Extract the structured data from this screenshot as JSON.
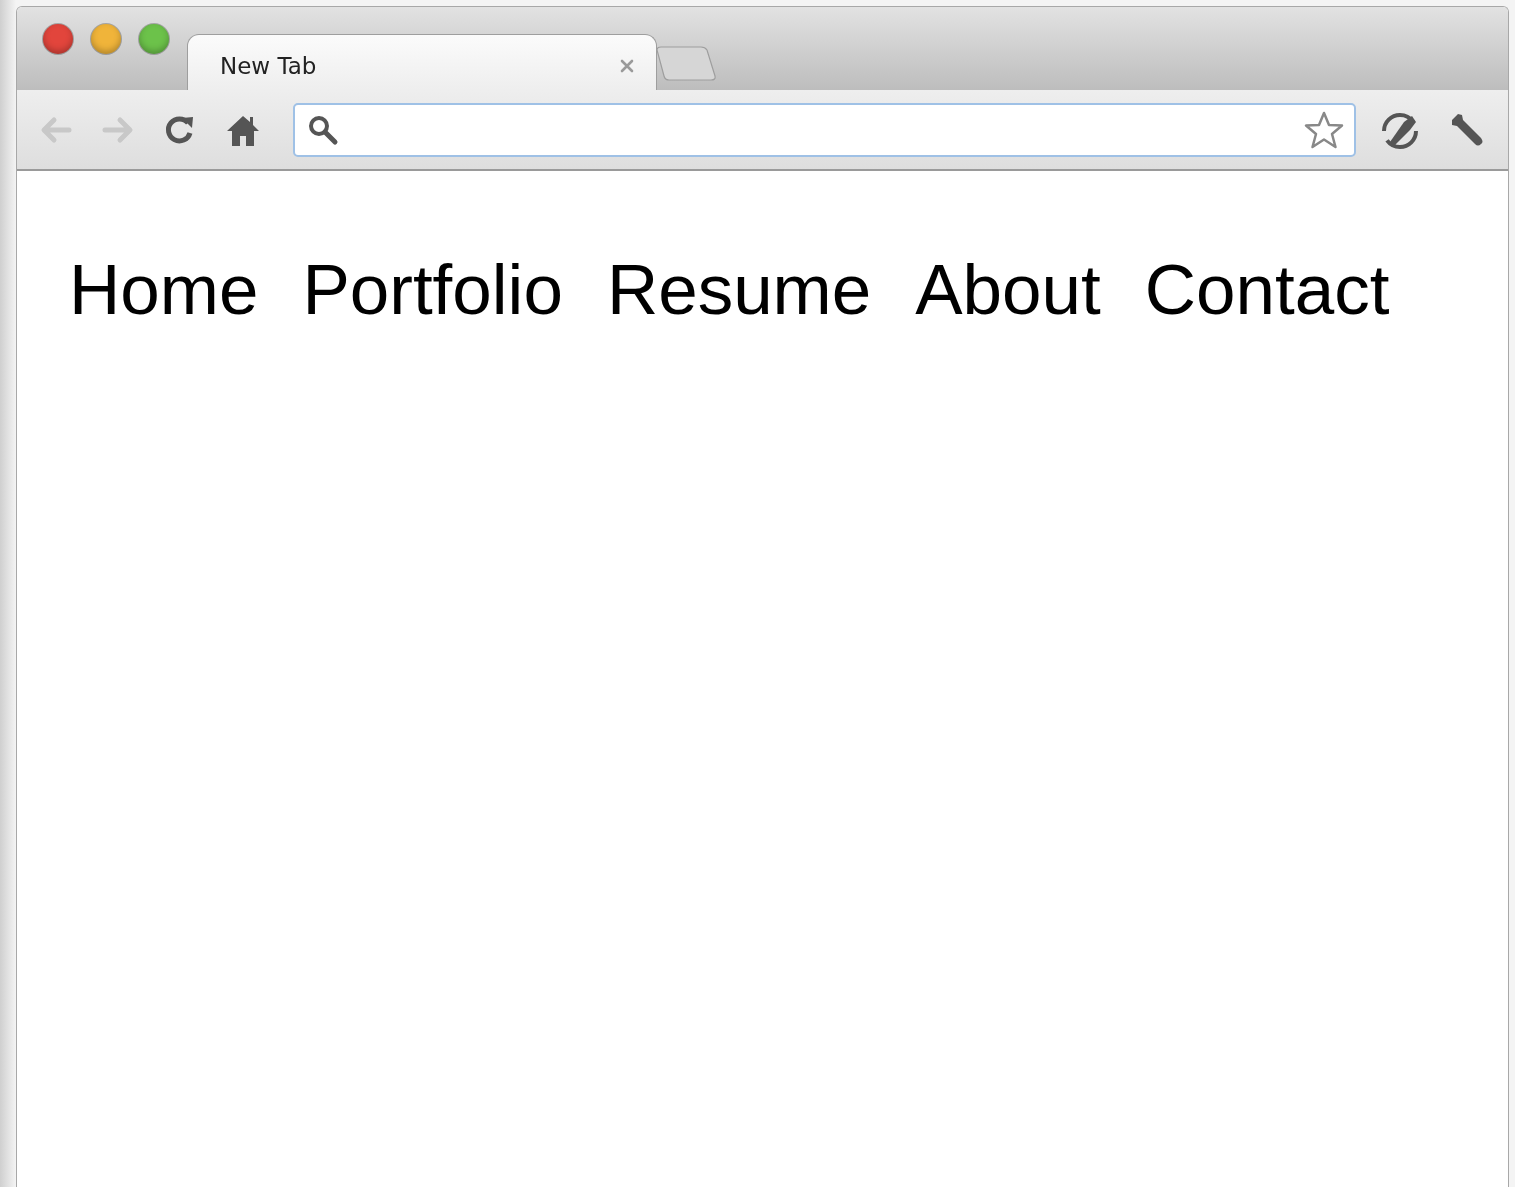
{
  "window": {
    "controls": [
      {
        "color": "#e2453c"
      },
      {
        "color": "#f0b43a"
      },
      {
        "color": "#6cc24a"
      }
    ]
  },
  "tabs": [
    {
      "title": "New Tab",
      "selected": true
    }
  ],
  "toolbar": {
    "buttons": [
      {
        "kind": "back",
        "disabled": true
      },
      {
        "kind": "forward",
        "disabled": true
      },
      {
        "kind": "reload",
        "disabled": false
      },
      {
        "kind": "home",
        "disabled": false
      }
    ]
  },
  "nav": {
    "links": [
      "Home",
      "Portfolio",
      "Resume",
      "About",
      "Contact"
    ]
  }
}
